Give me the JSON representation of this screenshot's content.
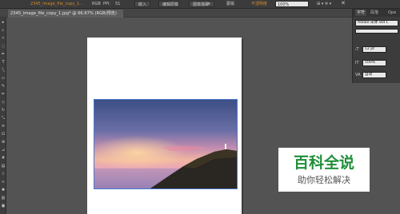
{
  "control_bar": {
    "linked_file": "2345_image_file_copy_1...",
    "color_mode": "RGB",
    "ppi_label": "PPI:",
    "ppi_value": "51",
    "embed_label": "嵌入",
    "edit_original_label": "编辑原稿",
    "image_trace_label": "图像描摹",
    "mask_label": "蒙版",
    "opacity_label": "不透明度",
    "opacity_value": "100%"
  },
  "document_tab": {
    "label": "2345_image_file_copy_1.jpg* @ 66.67% (RGB/预览)"
  },
  "character_panel": {
    "tabs": [
      "字符",
      "段落",
      "Ope"
    ],
    "font_family": "Adobe 宋体 Std L",
    "font_style": "-",
    "font_size": "12 pt",
    "leading": "100%",
    "tracking": "自动"
  },
  "watermark": {
    "title": "百科全说",
    "subtitle": "助你轻松解决"
  },
  "colors": {
    "workspace": "#535353",
    "accent_orange": "#d58b2a",
    "watermark_green": "#1f8f3a",
    "selection_blue": "#4a78c8"
  }
}
